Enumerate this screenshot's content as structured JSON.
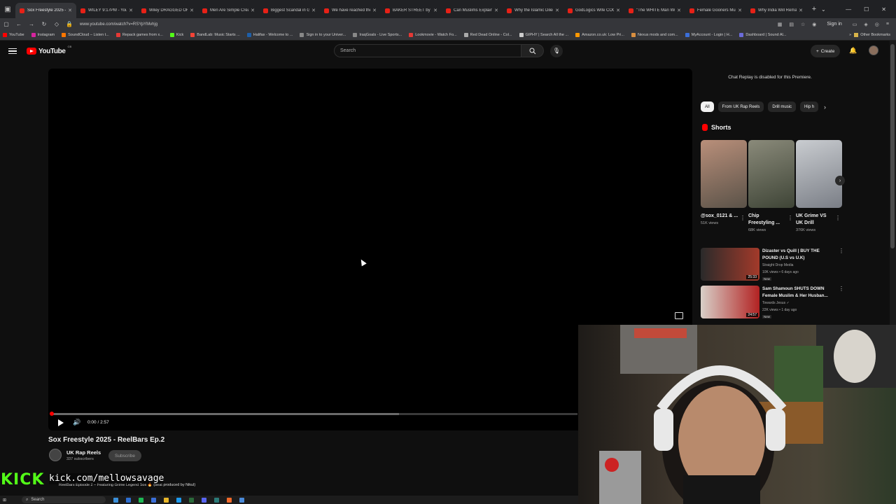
{
  "browser": {
    "tabs": [
      {
        "title": "Sox Freestyle 2025 - ReelBars",
        "active": true
      },
      {
        "title": "WILEY 9:17PM - YouTube",
        "active": false
      },
      {
        "title": "Wiley DRAGGED OFF",
        "active": false
      },
      {
        "title": "Men Are Simple Creatures",
        "active": false
      },
      {
        "title": "Biggest Scandal in Grime",
        "active": false
      },
      {
        "title": "We have reached the",
        "active": false
      },
      {
        "title": "BAKER STREET by Gerry",
        "active": false
      },
      {
        "title": "Can Muslims Explain",
        "active": false
      },
      {
        "title": "Why the Islamic Dilemma",
        "active": false
      },
      {
        "title": "GodLogics Wife COOKED",
        "active": false
      },
      {
        "title": "\"The WHITE Man Will",
        "active": false
      },
      {
        "title": "Female Gooners Must",
        "active": false
      },
      {
        "title": "Why India Will Remain",
        "active": false
      }
    ],
    "url": "www.youtube.com/watch?v=RSYpYMvhjg",
    "signin_label": "Sign in",
    "bookmarks": [
      {
        "label": "YouTube",
        "color": "#ff0000"
      },
      {
        "label": "Instagram",
        "color": "#d6249f"
      },
      {
        "label": "SoundCloud – Listen t...",
        "color": "#ff7700"
      },
      {
        "label": "Repack games from x...",
        "color": "#e53935"
      },
      {
        "label": "Kick",
        "color": "#53fc18"
      },
      {
        "label": "BandLab: Music Starts ...",
        "color": "#f44336"
      },
      {
        "label": "Halifax - Welcome to ...",
        "color": "#1e5fa8"
      },
      {
        "label": "Sign in to your Univer...",
        "color": "#888888"
      },
      {
        "label": "IraqGoals - Live Sports...",
        "color": "#888888"
      },
      {
        "label": "Lookmovie - Watch Fo...",
        "color": "#e53935"
      },
      {
        "label": "Red Dead Online - Col...",
        "color": "#aaaaaa"
      },
      {
        "label": "GIPHY | Search All the ...",
        "color": "#cccccc"
      },
      {
        "label": "Amazon.co.uk: Low Pri...",
        "color": "#ff9900"
      },
      {
        "label": "Nexus mods and com...",
        "color": "#d98f40"
      },
      {
        "label": "MyAccount - Login | H...",
        "color": "#3b6fd9"
      },
      {
        "label": "Dashboard | Sound Al...",
        "color": "#6b6bd9"
      }
    ],
    "other_bookmarks": "Other Bookmarks"
  },
  "youtube": {
    "logo_text": "YouTube",
    "country_code": "GB",
    "search_placeholder": "Search",
    "create_label": "Create",
    "player": {
      "timecode": "0:00 / 2:57",
      "progress_fraction": 0,
      "buffered_fraction": 0.66
    },
    "video_title": "Sox Freestyle 2025 - ReelBars Ep.2",
    "channel": {
      "name": "UK Rap Reels",
      "subscribers": "337 subscribers",
      "subscribe_label": "Subscribe"
    },
    "description": "ReelBars Episode 2 – Featuring Grime Legend Sox 🔥 (beat produced by Nikul)"
  },
  "sidebar": {
    "chat_message": "Chat Replay is disabled for this Premiere.",
    "chips": [
      "All",
      "From UK Rap Reels",
      "Drill music",
      "Hip h"
    ],
    "shorts_title": "Shorts",
    "shorts": [
      {
        "title": "@sox_0121 & ...",
        "views": "51K views",
        "colors": [
          "#5a5248",
          "#b98f7a"
        ]
      },
      {
        "title": "Chip Freestyling ...",
        "views": "68K views",
        "colors": [
          "#3e4436",
          "#8a8a7a"
        ]
      },
      {
        "title": "UK Grime VS UK Drill",
        "views": "376K views",
        "colors": [
          "#7a7e86",
          "#c9ccd0"
        ]
      }
    ],
    "recommendations": [
      {
        "title": "Dizaster vs Quill | BUY THE POUND (U.S vs U.K)",
        "channel": "Straight Drop Media",
        "meta": "10K views • 6 days ago",
        "badge": "New",
        "duration": "25:33",
        "colors": [
          "#2a2a2a",
          "#a33a2a"
        ]
      },
      {
        "title": "Sam Shamoun SHUTS DOWN Female Muslim & Her Husban...",
        "channel": "Towards Jesus ✓",
        "meta": "22K views • 1 day ago",
        "badge": "New",
        "duration": "24:57",
        "colors": [
          "#d8d0c8",
          "#b22222"
        ]
      }
    ]
  },
  "overlay": {
    "kick_logo": "KICK",
    "kick_url": "kick.com/mellowsavage"
  },
  "taskbar": {
    "search_label": "Search"
  }
}
